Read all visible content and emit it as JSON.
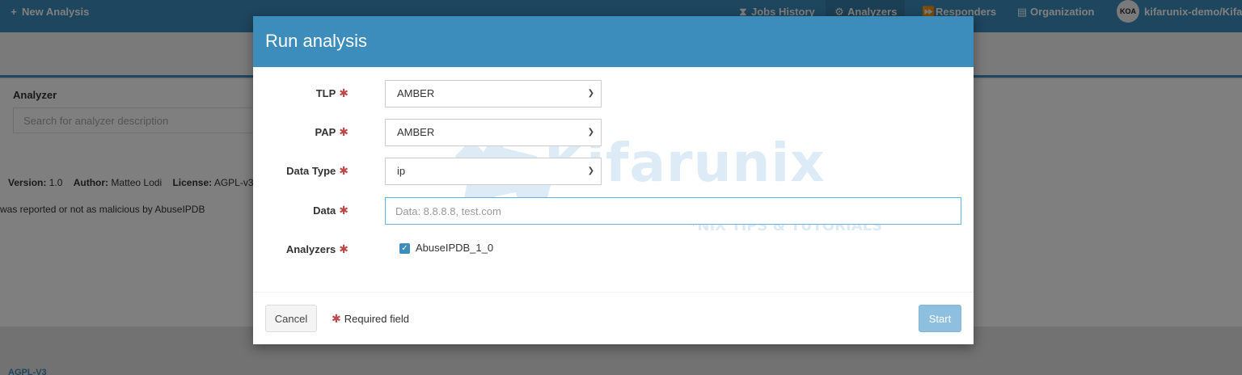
{
  "navbar": {
    "new_analysis": "New Analysis",
    "jobs_history": "Jobs History",
    "analyzers": "Analyzers",
    "responders": "Responders",
    "organization": "Organization",
    "avatar_initials": "KOA",
    "user": "kifarunix-demo/Kifa"
  },
  "page": {
    "analyzer_label": "Analyzer",
    "search_placeholder": "Search for analyzer description",
    "version_label": "Version:",
    "version_value": "1.0",
    "author_label": "Author:",
    "author_value": "Matteo Lodi",
    "license_label": "License:",
    "license_value": "AGPL-v3",
    "description": "was reported or not as malicious by AbuseIPDB",
    "footer_license": "AGPL-V3"
  },
  "modal": {
    "title": "Run analysis",
    "tlp_label": "TLP",
    "tlp_value": "AMBER",
    "pap_label": "PAP",
    "pap_value": "AMBER",
    "datatype_label": "Data Type",
    "datatype_value": "ip",
    "data_label": "Data",
    "data_placeholder": "Data: 8.8.8.8, test.com",
    "analyzers_label": "Analyzers",
    "analyzer_option": "AbuseIPDB_1_0",
    "required_mark": "✱",
    "cancel": "Cancel",
    "required_note": "Required field",
    "start": "Start"
  },
  "watermark": {
    "main": "Kifarunix",
    "sub": "*NIX TIPS & TUTORIALS"
  },
  "colors": {
    "primary": "#3c8dbc",
    "required": "#b94a48",
    "start_disabled": "#8ebfde"
  }
}
